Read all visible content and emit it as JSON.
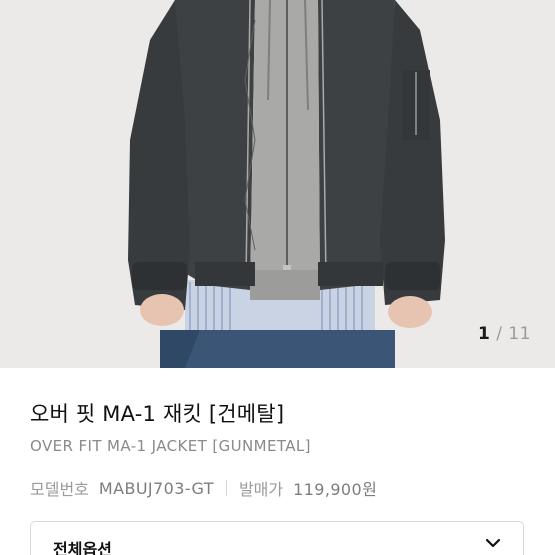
{
  "gallery": {
    "current": "1",
    "separator": "/",
    "total": "11"
  },
  "product": {
    "name": "오버 핏 MA-1 재킷 [건메탈]",
    "name_en": "OVER FIT MA-1 JACKET [GUNMETAL]",
    "model_label": "모델번호",
    "model_value": "MABUJ703-GT",
    "price_label": "발매가",
    "price_value": "119,900원"
  },
  "options": {
    "label": "전체옵션",
    "icon": "chevron-down-icon"
  },
  "colors": {
    "jacket": "#3c3f41",
    "hoodie": "#a9a9a7",
    "jeans": "#3a5575",
    "background": "#ecebe9"
  }
}
